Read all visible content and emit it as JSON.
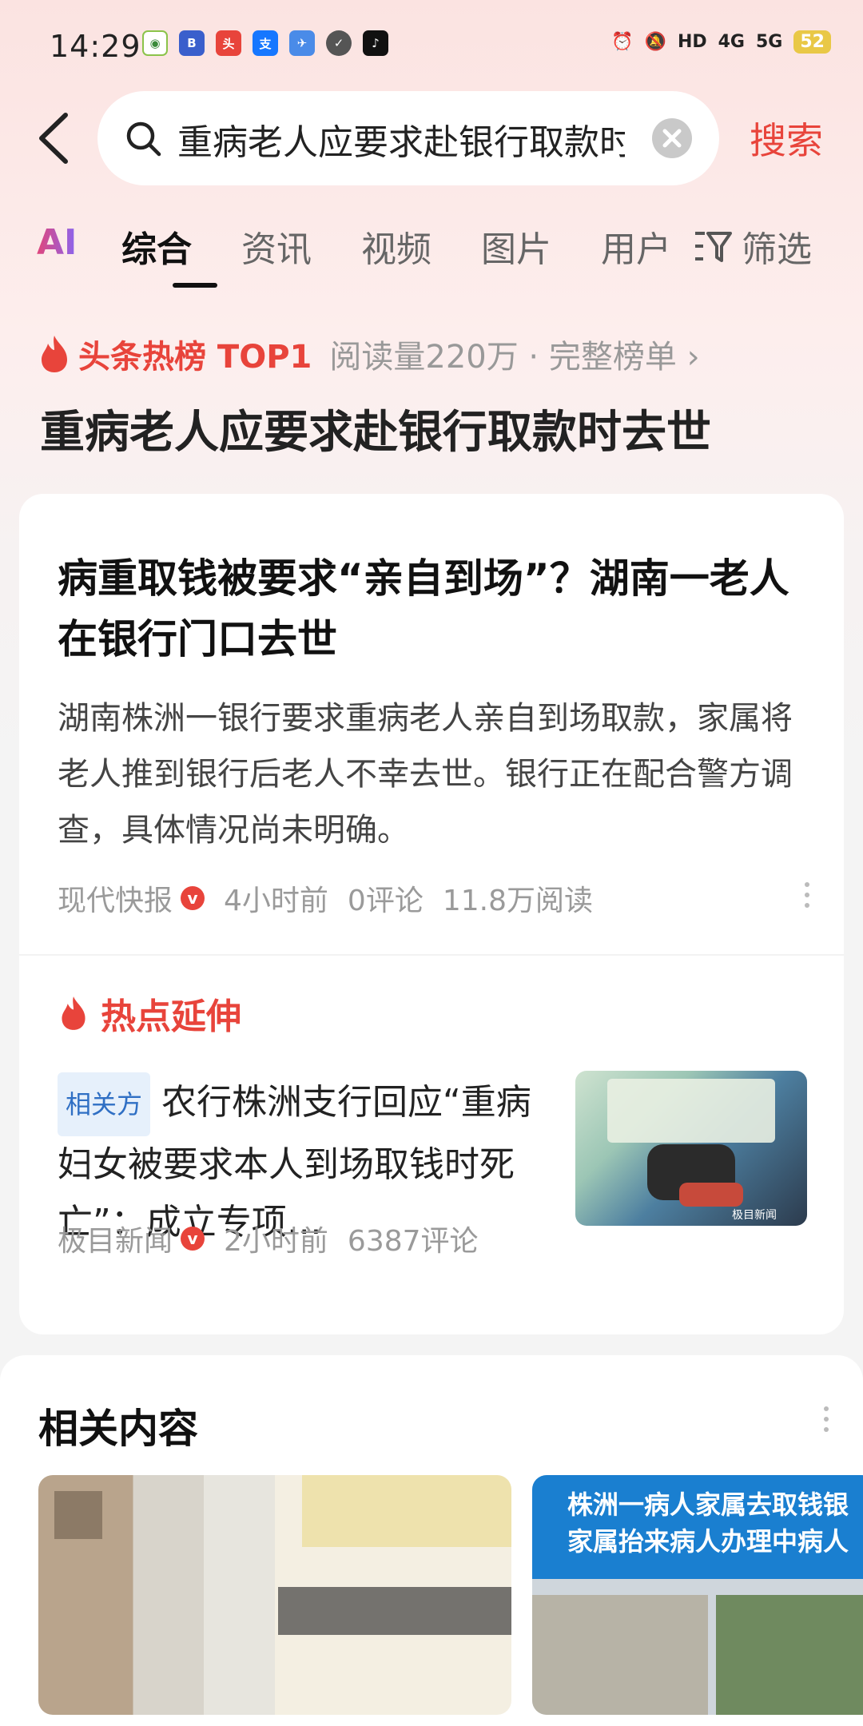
{
  "status_bar": {
    "time": "14:29",
    "app_icons": [
      "china-mobile-icon",
      "bank-icon",
      "toutiao-icon",
      "alipay-icon",
      "app-icon",
      "check-icon",
      "tiktok-icon"
    ],
    "battery": "52",
    "network": [
      "HD",
      "4G",
      "5G"
    ]
  },
  "search": {
    "query": "重病老人应要求赴银行取款时",
    "submit_label": "搜索"
  },
  "tabs": {
    "ai": "AI",
    "items": [
      "综合",
      "资讯",
      "视频",
      "图片",
      "用户"
    ],
    "filter": "筛选",
    "active_index": 0
  },
  "hot": {
    "label": "头条热榜 TOP1",
    "meta": "阅读量220万 · 完整榜单 ›",
    "title": "重病老人应要求赴银行取款时去世"
  },
  "main_article": {
    "title": "病重取钱被要求“亲自到场”？湖南一老人在银行门口去世",
    "summary": "湖南株洲一银行要求重病老人亲自到场取款，家属将老人推到银行后老人不幸去世。银行正在配合警方调查，具体情况尚未明确。",
    "source": "现代快报",
    "time": "4小时前",
    "comments": "0评论",
    "reads": "11.8万阅读"
  },
  "extension": {
    "title": "热点延伸",
    "tag": "相关方",
    "headline": "农行株洲支行回应“重病妇女被要求本人到场取钱时死亡”：成立专项…",
    "source": "极目新闻",
    "time": "2小时前",
    "comments": "6387评论",
    "thumb_watermark": "极目新闻"
  },
  "related": {
    "title": "相关内容",
    "card2_caption_1": "株洲一病人家属去取钱银",
    "card2_caption_2": "家属抬来病人办理中病人"
  },
  "colors": {
    "accent": "#e8443b",
    "tag_blue": "#2f6fc4"
  }
}
